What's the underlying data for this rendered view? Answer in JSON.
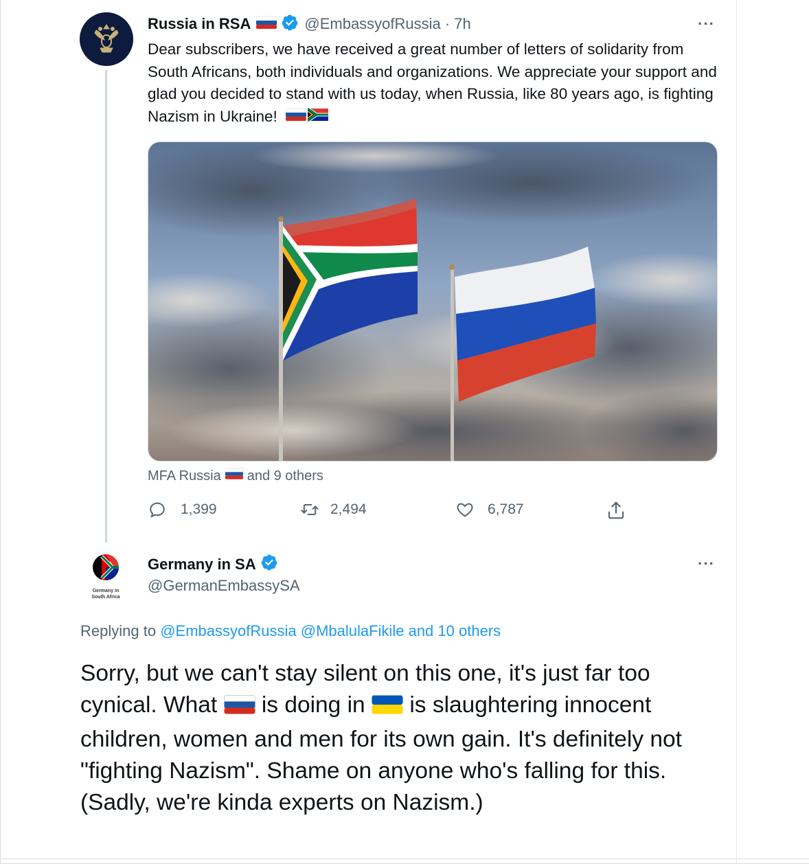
{
  "tweet1": {
    "name": "Russia in RSA",
    "handle": "@EmbassyofRussia",
    "time": "· 7h",
    "text": "Dear subscribers, we have received a great number of letters of solidarity from South Africans, both individuals and organizations. We appreciate your support and glad you decided to stand with us today, when Russia, like 80 years ago, is fighting Nazism in Ukraine!",
    "tagged_prefix": "MFA Russia",
    "tagged_suffix": "and 9 others",
    "replies": "1,399",
    "retweets": "2,494",
    "likes": "6,787",
    "more": "···",
    "icons": [
      "avatar-emblem-icon",
      "russia-flag-icon",
      "verified-icon",
      "south-africa-flag-icon",
      "reply-icon",
      "retweet-icon",
      "like-icon",
      "share-icon",
      "more-icon"
    ]
  },
  "tweet2": {
    "name": "Germany in SA",
    "handle": "@GermanEmbassySA",
    "more": "···",
    "avatar_caption": "Germany in South Africa",
    "replying_label": "Replying to",
    "replying_handle1": "@EmbassyofRussia",
    "replying_handle2": "@MbalulaFikile",
    "replying_others": "and 10 others",
    "text_part1": "Sorry, but we can't stay silent on this one, it's just far too cynical. What",
    "text_part2": "is doing in",
    "text_part3": "is slaughtering innocent children, women and men for its own gain. It's definitely not \"fighting Nazism\". Shame on anyone who's falling for this. (Sadly, we're kinda experts on Nazism.)"
  },
  "colors": {
    "link": "#1d9bf0",
    "muted": "#536471",
    "text": "#0f1419",
    "verified": "#1d9bf0",
    "thread_line": "#cfd9de"
  }
}
